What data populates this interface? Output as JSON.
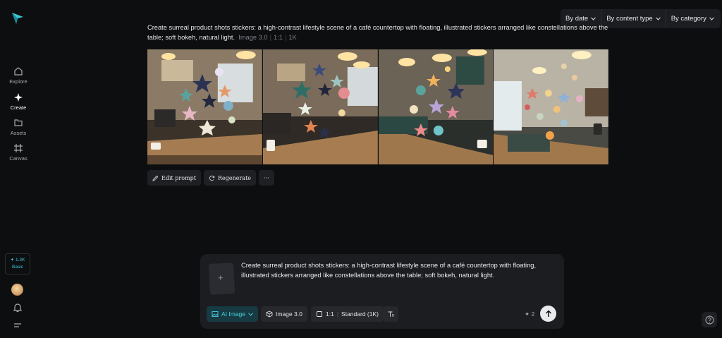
{
  "sidebar": {
    "items": [
      {
        "label": "Explore",
        "icon": "home-icon"
      },
      {
        "label": "Create",
        "icon": "sparkle-icon"
      },
      {
        "label": "Assets",
        "icon": "folder-icon"
      },
      {
        "label": "Canvas",
        "icon": "canvas-icon"
      }
    ],
    "credits_amount": "✦ 1.3K",
    "credits_plan": "Basic"
  },
  "filters": {
    "by_date": "By date",
    "by_content_type": "By content type",
    "by_category": "By category"
  },
  "generation": {
    "prompt": "Create surreal product shots stickers: a high-contrast lifestyle scene of a café countertop with floating, illustrated stickers arranged like constellations above the table; soft bokeh, natural light.",
    "model": "Image 3.0",
    "ratio": "1:1",
    "resolution": "1K"
  },
  "actions": {
    "edit_prompt": "Edit prompt",
    "regenerate": "Regenerate",
    "more": "···"
  },
  "composer": {
    "text": "Create surreal product shots stickers: a high-contrast lifestyle scene of a café countertop with floating, illustrated stickers arranged like constellations above the table; soft bokeh, natural light.",
    "thumb_plus": "+",
    "mode": "AI Image",
    "model": "Image 3.0",
    "ratio": "1:1",
    "quality": "Standard (1K)",
    "cost": "✦ 2"
  },
  "colors": {
    "accent": "#3ec7d6",
    "background": "#0d0e10",
    "panel": "#1c1d21"
  }
}
